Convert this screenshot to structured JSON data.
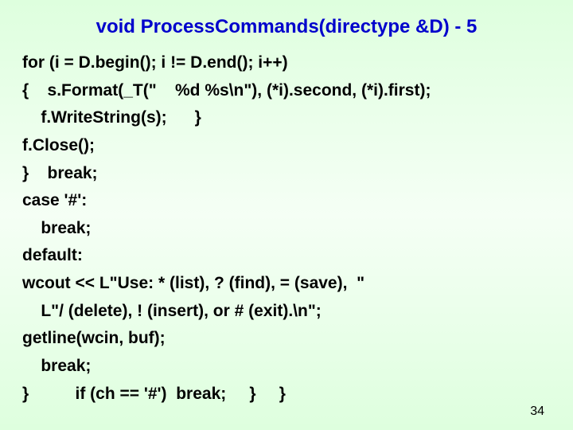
{
  "title": "void ProcessCommands(directype  &D) - 5",
  "lines": {
    "l0": "for (i = D.begin(); i != D.end(); i++)",
    "l1": "{    s.Format(_T(\"    %d %s\\n\"), (*i).second, (*i).first);",
    "l2": "    f.WriteString(s);      }",
    "l3": "f.Close();",
    "l4": "}    break;",
    "l5": "case '#':",
    "l6": "    break;",
    "l7": "default:",
    "l8": "wcout << L\"Use: * (list), ? (find), = (save),  \"",
    "l9": "    L\"/ (delete), ! (insert), or # (exit).\\n\";",
    "l10": "getline(wcin, buf);",
    "l11": "    break;",
    "l12": "}          if (ch == '#')  break;     }     }"
  },
  "page_number": "34"
}
